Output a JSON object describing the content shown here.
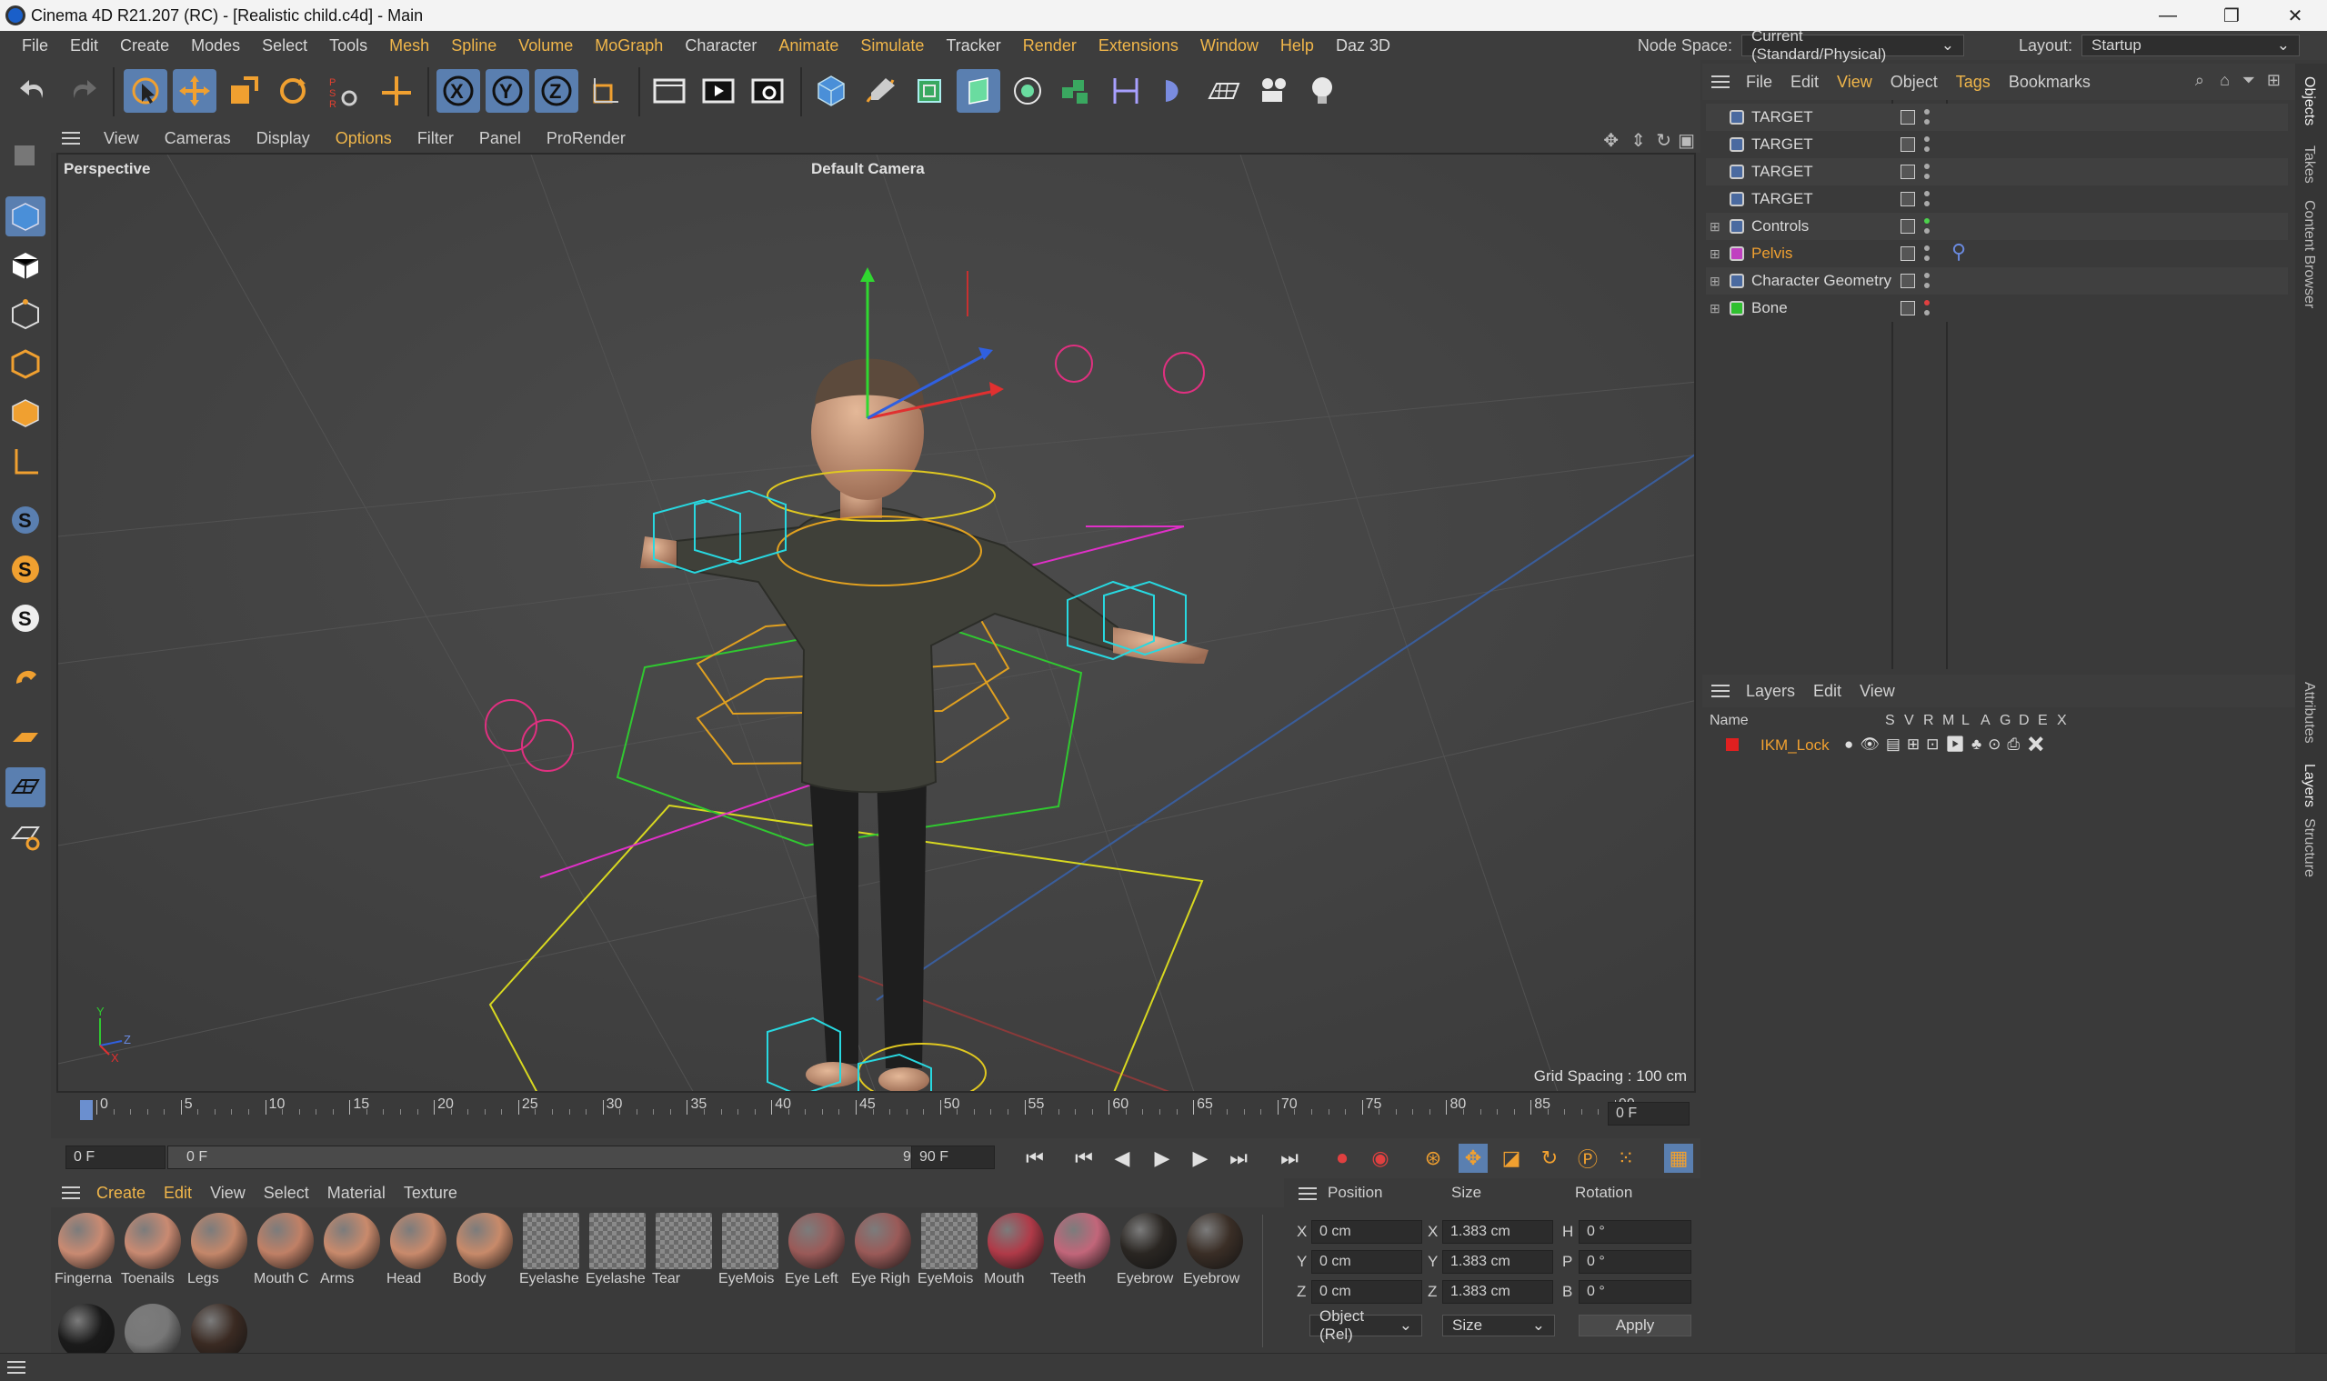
{
  "window": {
    "title": "Cinema 4D R21.207 (RC) - [Realistic child.c4d] - Main",
    "minimize": "—",
    "maximize": "❐",
    "close": "✕"
  },
  "menubar": {
    "items": [
      "File",
      "Edit",
      "Create",
      "Modes",
      "Select",
      "Tools",
      "Mesh",
      "Spline",
      "Volume",
      "MoGraph",
      "Character",
      "Animate",
      "Simulate",
      "Tracker",
      "Render",
      "Extensions",
      "Window",
      "Help",
      "Daz 3D"
    ],
    "highlighted": [
      "Mesh",
      "Spline",
      "Volume",
      "MoGraph",
      "Animate",
      "Simulate",
      "Render",
      "Extensions",
      "Window",
      "Help"
    ],
    "node_space_label": "Node Space:",
    "node_space_value": "Current (Standard/Physical)",
    "layout_label": "Layout:",
    "layout_value": "Startup"
  },
  "toolbar": {
    "icons": [
      "undo-icon",
      "redo-icon",
      "live-selection-icon",
      "move-icon",
      "scale-icon",
      "rotate-icon",
      "psr-icon",
      "add-axis-icon",
      "x-axis-icon",
      "y-axis-icon",
      "z-axis-icon",
      "coordinate-system-icon",
      "render-view-icon",
      "render-picture-viewer-icon",
      "render-settings-icon",
      "cube-icon",
      "pen-icon",
      "subdivision-icon",
      "extrude-icon",
      "cloner-icon",
      "deformer-icon",
      "field-icon",
      "scene-icon",
      "camera-icon",
      "light-icon"
    ]
  },
  "viewport": {
    "menu": [
      "View",
      "Cameras",
      "Display",
      "Options",
      "Filter",
      "Panel",
      "ProRender"
    ],
    "highlighted": "Options",
    "label": "Perspective",
    "camera": "Default Camera",
    "grid_spacing": "Grid Spacing : 100 cm",
    "axis_x": "X",
    "axis_y": "Y",
    "axis_z": "Z"
  },
  "timeline": {
    "ticks": [
      "0",
      "5",
      "10",
      "15",
      "20",
      "25",
      "30",
      "35",
      "40",
      "45",
      "50",
      "55",
      "60",
      "65",
      "70",
      "75",
      "80",
      "85",
      "90"
    ],
    "current_frame": "0 F",
    "start_frame": "0 F",
    "range_start": "0 F",
    "range_end": "90 F",
    "end_frame": "90 F",
    "range_position": 0.0
  },
  "materials": {
    "menu": [
      "Create",
      "Edit",
      "View",
      "Select",
      "Material",
      "Texture"
    ],
    "highlighted": [
      "Create",
      "Edit"
    ],
    "items": [
      {
        "name": "Fingerna",
        "color": "#c98a72"
      },
      {
        "name": "Toenails",
        "color": "#c98a72"
      },
      {
        "name": "Legs",
        "color": "#c4876a"
      },
      {
        "name": "Mouth C",
        "color": "#c08066"
      },
      {
        "name": "Arms",
        "color": "#c98a6c"
      },
      {
        "name": "Head",
        "color": "#c98a6c"
      },
      {
        "name": "Body",
        "color": "#c88a6a"
      },
      {
        "name": "Eyelashe",
        "color": "checker"
      },
      {
        "name": "Eyelashe",
        "color": "checker"
      },
      {
        "name": "Tear",
        "color": "checker"
      },
      {
        "name": "EyeMois",
        "color": "checker"
      },
      {
        "name": "Eye Left",
        "color": "#9a5a58"
      },
      {
        "name": "Eye Righ",
        "color": "#9a5a58"
      },
      {
        "name": "EyeMois",
        "color": "checker"
      },
      {
        "name": "Mouth",
        "color": "#b03a48"
      },
      {
        "name": "Teeth",
        "color": "#c2667a"
      },
      {
        "name": "Eyebrow",
        "color": "#2a2622"
      },
      {
        "name": "Eyebrow",
        "color": "#3a2e26"
      },
      {
        "name": "",
        "color": "#1a1a1a"
      },
      {
        "name": "",
        "color": "#777777"
      },
      {
        "name": "",
        "color": "#3a2a22"
      }
    ]
  },
  "coordinates": {
    "headers": [
      "Position",
      "Size",
      "Rotation"
    ],
    "rows": [
      {
        "axis": "X",
        "pos": "0 cm",
        "size_axis": "X",
        "size": "1.383 cm",
        "rot_axis": "H",
        "rot": "0 °"
      },
      {
        "axis": "Y",
        "pos": "0 cm",
        "size_axis": "Y",
        "size": "1.383 cm",
        "rot_axis": "P",
        "rot": "0 °"
      },
      {
        "axis": "Z",
        "pos": "0 cm",
        "size_axis": "Z",
        "size": "1.383 cm",
        "rot_axis": "B",
        "rot": "0 °"
      }
    ],
    "mode": "Object (Rel)",
    "size_mode": "Size",
    "apply": "Apply"
  },
  "objects": {
    "menu": [
      "File",
      "Edit",
      "View",
      "Object",
      "Tags",
      "Bookmarks"
    ],
    "highlighted": [
      "View",
      "Tags"
    ],
    "rows": [
      {
        "name": "TARGET",
        "color": "#d8d8d8",
        "expand": false,
        "dot": "#aaaaaa"
      },
      {
        "name": "TARGET",
        "color": "#d8d8d8",
        "expand": false,
        "dot": "#aaaaaa"
      },
      {
        "name": "TARGET",
        "color": "#d8d8d8",
        "expand": false,
        "dot": "#aaaaaa"
      },
      {
        "name": "TARGET",
        "color": "#d8d8d8",
        "expand": false,
        "dot": "#aaaaaa"
      },
      {
        "name": "Controls",
        "color": "#d8d8d8",
        "expand": true,
        "dot": "#4cd24c"
      },
      {
        "name": "Pelvis",
        "color": "#f0a030",
        "expand": true,
        "dot": "#aaaaaa"
      },
      {
        "name": "Character Geometry",
        "color": "#d8d8d8",
        "expand": true,
        "dot": "#aaaaaa"
      },
      {
        "name": "Bone",
        "color": "#d8d8d8",
        "expand": true,
        "dot": "#e04040"
      }
    ]
  },
  "layers": {
    "menu": [
      "Layers",
      "Edit",
      "View"
    ],
    "columns": [
      "Name",
      "S",
      "V",
      "R",
      "M",
      "L",
      "A",
      "G",
      "D",
      "E",
      "X"
    ],
    "rows": [
      {
        "name": "IKM_Lock",
        "color": "#e02020"
      }
    ]
  },
  "side_tabs": [
    "Objects",
    "Takes",
    "Content Browser",
    "Attributes",
    "Layers",
    "Structure"
  ]
}
